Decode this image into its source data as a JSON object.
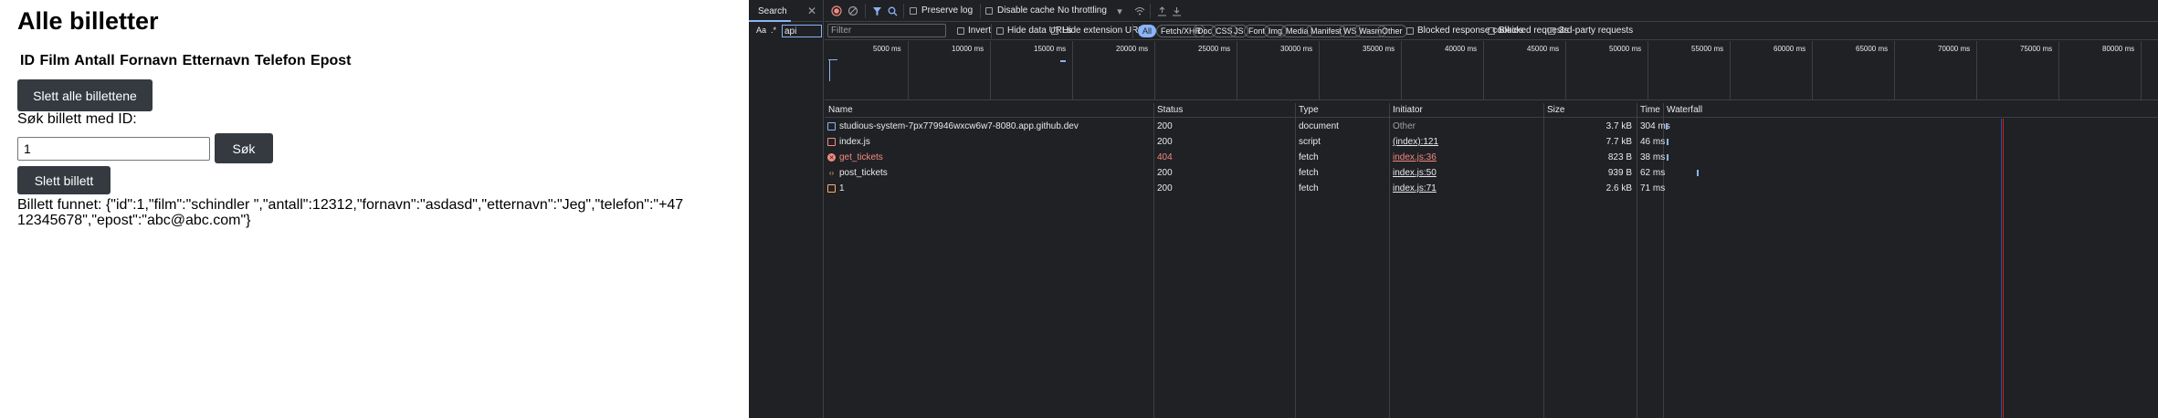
{
  "page": {
    "title": "Alle billetter",
    "table_header": "ID Film Antall Fornavn Etternavn Telefon Epost",
    "delete_all_label": "Slett alle billettene",
    "search_label": "Søk billett med ID:",
    "search_value": "1",
    "search_button": "Søk",
    "delete_ticket_label": "Slett billett",
    "result_text": "Billett funnet: {\"id\":1,\"film\":\"schindler \",\"antall\":12312,\"fornavn\":\"asdasd\",\"etternavn\":\"Jeg\",\"telefon\":\"+47 12345678\",\"epost\":\"abc@abc.com\"}"
  },
  "devtools": {
    "search_panel": {
      "tab_label": "Search",
      "case_toggle": "Aa",
      "regex_toggle": ".*",
      "query": "api"
    },
    "toolbar": {
      "preserve_log": "Preserve log",
      "disable_cache": "Disable cache",
      "throttling": "No throttling"
    },
    "filter_bar": {
      "filter_placeholder": "Filter",
      "invert": "Invert",
      "hide_data_urls": "Hide data URLs",
      "hide_extension_urls": "Hide extension URLs",
      "types": [
        "All",
        "Fetch/XHR",
        "Doc",
        "CSS",
        "JS",
        "Font",
        "Img",
        "Media",
        "Manifest",
        "WS",
        "Wasm",
        "Other"
      ],
      "active_type": "All",
      "blocked_cookies": "Blocked response cookies",
      "blocked_requests": "Blocked requests",
      "third_party": "3rd-party requests"
    },
    "overview_ticks": [
      "5000 ms",
      "10000 ms",
      "15000 ms",
      "20000 ms",
      "25000 ms",
      "30000 ms",
      "35000 ms",
      "40000 ms",
      "45000 ms",
      "50000 ms",
      "55000 ms",
      "60000 ms",
      "65000 ms",
      "70000 ms",
      "75000 ms",
      "80000 ms"
    ],
    "columns": {
      "name": "Name",
      "status": "Status",
      "type": "Type",
      "initiator": "Initiator",
      "size": "Size",
      "time": "Time",
      "waterfall": "Waterfall"
    },
    "requests": [
      {
        "name": "studious-system-7px779946wxcw6w7-8080.app.github.dev",
        "status": "200",
        "type": "document",
        "initiator": "Other",
        "size": "3.7 kB",
        "time": "304 ms",
        "icon": "document-icon"
      },
      {
        "name": "index.js",
        "status": "200",
        "type": "script",
        "initiator": "(index):121",
        "size": "7.7 kB",
        "time": "46 ms",
        "icon": "script-icon"
      },
      {
        "name": "get_tickets",
        "status": "404",
        "type": "fetch",
        "initiator": "index.js:36",
        "size": "823 B",
        "time": "38 ms",
        "icon": "error-icon"
      },
      {
        "name": "post_tickets",
        "status": "200",
        "type": "fetch",
        "initiator": "index.js:50",
        "size": "939 B",
        "time": "62 ms",
        "icon": "xhr-icon"
      },
      {
        "name": "1",
        "status": "200",
        "type": "fetch",
        "initiator": "index.js:71",
        "size": "2.6 kB",
        "time": "71 ms",
        "icon": "fetch-icon"
      }
    ],
    "colors": {
      "accent": "#8ab4f8",
      "error": "#f28b82",
      "background": "#202124"
    }
  }
}
